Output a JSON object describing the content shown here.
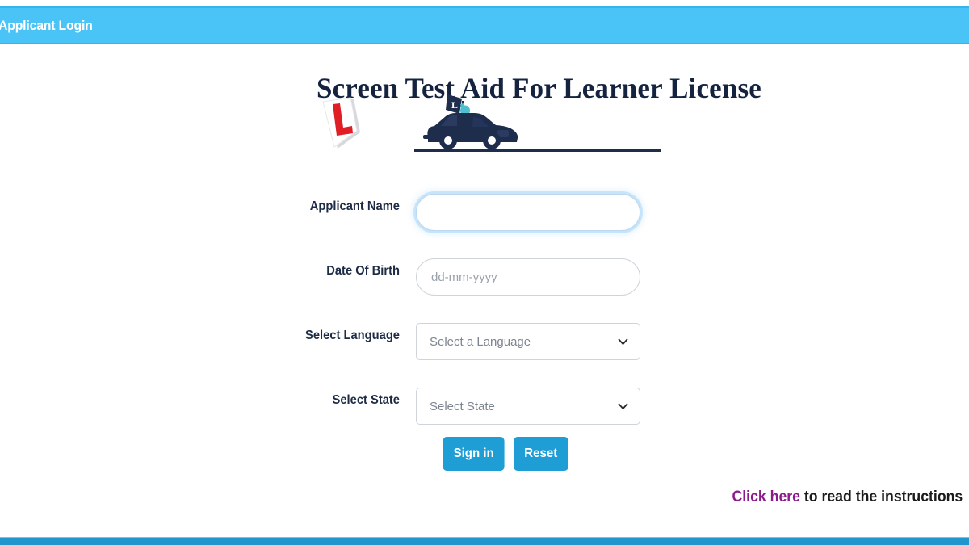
{
  "header": {
    "title": "Applicant Login",
    "background_color": "#4ac3f7"
  },
  "brand": {
    "title": "Screen Test Aid For Learner License",
    "lplate_icon": "learner-plate-icon",
    "lplate_letter": "L",
    "car_icon": "learner-car-icon",
    "flag_letter": "L",
    "title_color": "#15233f",
    "car_color": "#1f2d4d",
    "driver_color": "#4dbfcf",
    "lplate_color": "#e01e26"
  },
  "form": {
    "fields": [
      {
        "label": "Applicant Name",
        "type": "text",
        "value": "",
        "placeholder": "",
        "name": "applicant-name-input",
        "focused": true
      },
      {
        "label": "Date Of Birth",
        "type": "text",
        "value": "",
        "placeholder": "dd-mm-yyyy",
        "name": "date-of-birth-input",
        "focused": false
      },
      {
        "label": "Select Language",
        "type": "select",
        "value": "Select a Language",
        "name": "language-select",
        "options": [
          "Select a Language"
        ]
      },
      {
        "label": "Select State",
        "type": "select",
        "value": "Select State",
        "name": "state-select",
        "options": [
          "Select State"
        ]
      }
    ],
    "buttons": {
      "submit_label": "Sign in",
      "reset_label": "Reset",
      "color": "#1f9ed5"
    }
  },
  "instructions": {
    "link_text": "Click here",
    "rest_text": " to read the instructions",
    "link_color": "#8b1a8b"
  },
  "footer": {
    "background_color": "#2196ce"
  }
}
